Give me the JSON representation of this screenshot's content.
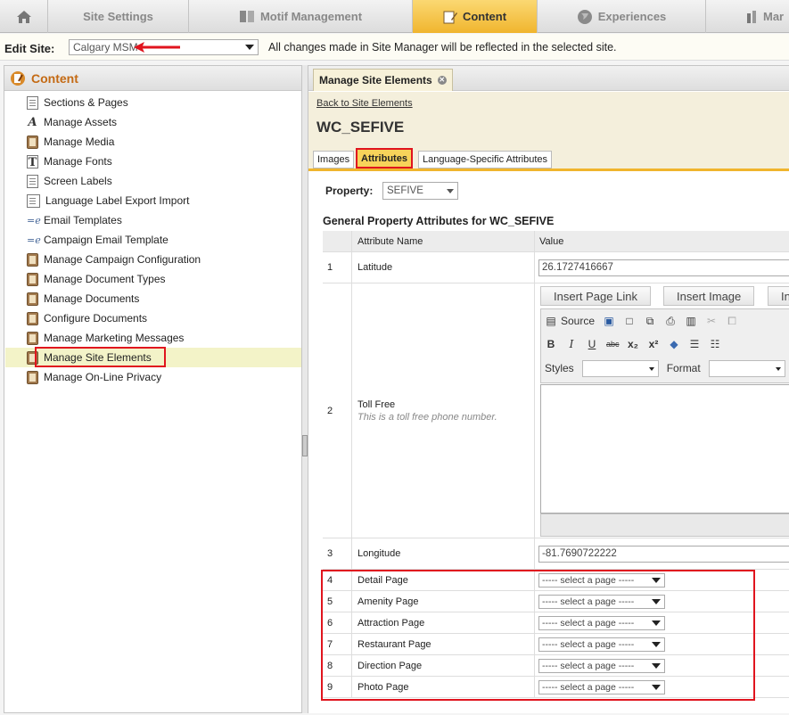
{
  "topnav": {
    "tabs": [
      {
        "label": "",
        "icon": "home-icon"
      },
      {
        "label": "Site Settings"
      },
      {
        "label": "Motif Management",
        "icon": "motif-icon"
      },
      {
        "label": "Content",
        "icon": "content-icon",
        "active": true
      },
      {
        "label": "Experiences",
        "icon": "globe-icon"
      },
      {
        "label": "Mar",
        "icon": "marketing-icon"
      }
    ]
  },
  "sitebar": {
    "label": "Edit Site:",
    "selected_site": "Calgary MSM",
    "note": "All changes made in Site Manager will be reflected in the selected site."
  },
  "left": {
    "title": "Content",
    "items": [
      {
        "label": "Sections & Pages",
        "icon": "page-icon"
      },
      {
        "label": "Manage Assets",
        "icon": "font-a-icon"
      },
      {
        "label": "Manage Media",
        "icon": "media-icon"
      },
      {
        "label": "Manage Fonts",
        "icon": "font-t-icon"
      },
      {
        "label": "Screen Labels",
        "icon": "page-icon"
      },
      {
        "label": "Language Label Export Import",
        "icon": "page-icon"
      },
      {
        "label": "Email Templates",
        "icon": "email-icon"
      },
      {
        "label": "Campaign Email Template",
        "icon": "email-icon"
      },
      {
        "label": "Manage Campaign Configuration",
        "icon": "book-icon"
      },
      {
        "label": "Manage Document Types",
        "icon": "book-icon"
      },
      {
        "label": "Manage Documents",
        "icon": "book-icon"
      },
      {
        "label": "Configure Documents",
        "icon": "book-icon"
      },
      {
        "label": "Manage Marketing Messages",
        "icon": "book-icon"
      },
      {
        "label": "Manage Site Elements",
        "icon": "book-icon",
        "selected": true
      },
      {
        "label": "Manage On-Line Privacy",
        "icon": "book-icon"
      }
    ]
  },
  "right": {
    "tab_label": "Manage Site Elements",
    "back_link": "Back to Site Elements",
    "element_title": "WC_SEFIVE",
    "subtabs": [
      "Images",
      "Attributes",
      "Language-Specific Attributes"
    ],
    "property_label": "Property:",
    "property_value": "SEFIVE",
    "section_title": "General Property Attributes for WC_SEFIVE",
    "columns": [
      "Attribute Name",
      "Value"
    ],
    "rows": [
      {
        "num": "1",
        "name": "Latitude",
        "value": "26.1727416667"
      },
      {
        "num": "2",
        "name": "Toll Free",
        "description": "This is a toll free phone number."
      },
      {
        "num": "3",
        "name": "Longitude",
        "value": "-81.7690722222"
      },
      {
        "num": "4",
        "name": "Detail Page",
        "select": "----- select a page -----"
      },
      {
        "num": "5",
        "name": "Amenity Page",
        "select": "----- select a page -----"
      },
      {
        "num": "6",
        "name": "Attraction Page",
        "select": "----- select a page -----"
      },
      {
        "num": "7",
        "name": "Restaurant Page",
        "select": "----- select a page -----"
      },
      {
        "num": "8",
        "name": "Direction Page",
        "select": "----- select a page -----"
      },
      {
        "num": "9",
        "name": "Photo Page",
        "select": "----- select a page -----"
      }
    ],
    "editor": {
      "buttons": [
        "Insert Page Link",
        "Insert Image",
        "In"
      ],
      "source_label": "Source",
      "styles_label": "Styles",
      "format_label": "Format"
    }
  },
  "colors": {
    "accent": "#f0b52e",
    "highlight_red": "#e0141e",
    "left_title": "#c46a14"
  }
}
